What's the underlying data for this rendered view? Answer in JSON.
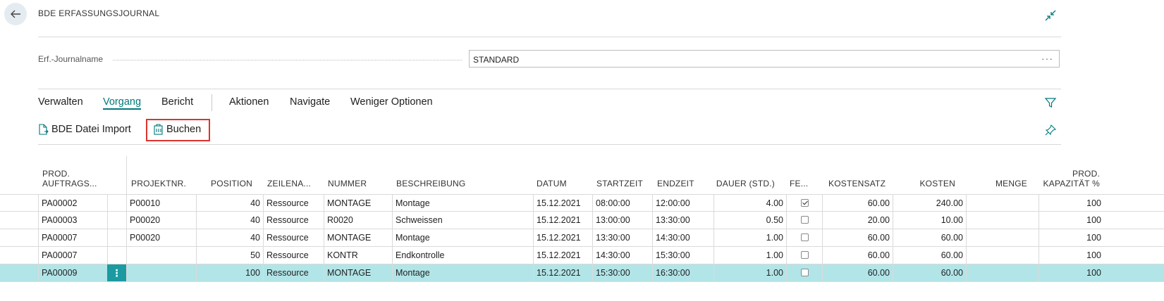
{
  "header": {
    "title": "BDE ERFASSUNGSJOURNAL"
  },
  "field": {
    "label": "Erf.-Journalname",
    "value": "STANDARD",
    "more": "···"
  },
  "actions": {
    "tabs": [
      {
        "label": "Verwalten"
      },
      {
        "label": "Vorgang"
      },
      {
        "label": "Bericht"
      },
      {
        "label": "Aktionen"
      },
      {
        "label": "Navigate"
      },
      {
        "label": "Weniger Optionen"
      }
    ],
    "active_tab": "Vorgang",
    "sub": [
      {
        "label": "BDE Datei Import"
      },
      {
        "label": "Buchen"
      }
    ]
  },
  "table": {
    "columns": [
      {
        "line1": "PROD.",
        "line2": "AUFTRAGS..."
      },
      {
        "line1": "",
        "line2": ""
      },
      {
        "line1": "",
        "line2": "PROJEKTNR."
      },
      {
        "line1": "",
        "line2": "POSITION"
      },
      {
        "line1": "",
        "line2": "ZEILENA..."
      },
      {
        "line1": "",
        "line2": "NUMMER"
      },
      {
        "line1": "",
        "line2": "BESCHREIBUNG"
      },
      {
        "line1": "",
        "line2": "DATUM"
      },
      {
        "line1": "",
        "line2": "STARTZEIT"
      },
      {
        "line1": "",
        "line2": "ENDZEIT"
      },
      {
        "line1": "",
        "line2": "DAUER (STD.)"
      },
      {
        "line1": "",
        "line2": "FE..."
      },
      {
        "line1": "",
        "line2": "KOSTENSATZ"
      },
      {
        "line1": "",
        "line2": "KOSTEN"
      },
      {
        "line1": "",
        "line2": "MENGE"
      },
      {
        "line1": "PROD.",
        "line2": "KAPAZITÄT %"
      }
    ],
    "rows": [
      {
        "auftrag": "PA00002",
        "projekt": "P00010",
        "position": "40",
        "zeilenart": "Ressource",
        "nummer": "MONTAGE",
        "beschreibung": "Montage",
        "datum": "15.12.2021",
        "start": "08:00:00",
        "ende": "12:00:00",
        "dauer": "4.00",
        "fertig": true,
        "kostensatz": "60.00",
        "kosten": "240.00",
        "menge": "",
        "kapazitaet": "100"
      },
      {
        "auftrag": "PA00003",
        "projekt": "P00020",
        "position": "40",
        "zeilenart": "Ressource",
        "nummer": "R0020",
        "beschreibung": "Schweissen",
        "datum": "15.12.2021",
        "start": "13:00:00",
        "ende": "13:30:00",
        "dauer": "0.50",
        "fertig": false,
        "kostensatz": "20.00",
        "kosten": "10.00",
        "menge": "",
        "kapazitaet": "100"
      },
      {
        "auftrag": "PA00007",
        "projekt": "P00020",
        "position": "40",
        "zeilenart": "Ressource",
        "nummer": "MONTAGE",
        "beschreibung": "Montage",
        "datum": "15.12.2021",
        "start": "13:30:00",
        "ende": "14:30:00",
        "dauer": "1.00",
        "fertig": false,
        "kostensatz": "60.00",
        "kosten": "60.00",
        "menge": "",
        "kapazitaet": "100"
      },
      {
        "auftrag": "PA00007",
        "projekt": "",
        "position": "50",
        "zeilenart": "Ressource",
        "nummer": "KONTR",
        "beschreibung": "Endkontrolle",
        "datum": "15.12.2021",
        "start": "14:30:00",
        "ende": "15:30:00",
        "dauer": "1.00",
        "fertig": false,
        "kostensatz": "60.00",
        "kosten": "60.00",
        "menge": "",
        "kapazitaet": "100"
      },
      {
        "auftrag": "PA00009",
        "projekt": "",
        "position": "100",
        "zeilenart": "Ressource",
        "nummer": "MONTAGE",
        "beschreibung": "Montage",
        "datum": "15.12.2021",
        "start": "15:30:00",
        "ende": "16:30:00",
        "dauer": "1.00",
        "fertig": false,
        "kostensatz": "60.00",
        "kosten": "60.00",
        "menge": "",
        "kapazitaet": "100"
      }
    ],
    "selected_row": 4,
    "row_menu_glyph": "⋮"
  },
  "icons": {
    "back": "back-arrow-icon",
    "collapse": "collapse-icon",
    "filter": "filter-icon",
    "pin": "pin-icon",
    "import": "document-import-icon",
    "post": "post-icon"
  },
  "colors": {
    "accent": "#00787a",
    "selected_row": "#b2e5e8",
    "highlight_box": "#d9352e",
    "row_menu": "#1b9aa2"
  }
}
